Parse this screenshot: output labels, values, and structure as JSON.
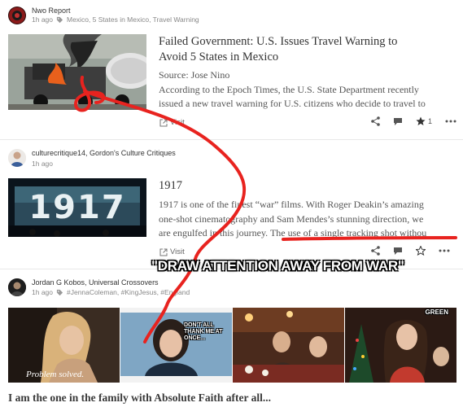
{
  "posts": [
    {
      "user": "Nwo Report",
      "time": "1h ago",
      "tags": "Mexico, 5 States in Mexico, Travel Warning",
      "title_line1": "Failed Government: U.S. Issues Travel Warning to",
      "title_line2": "Avoid 5 States in Mexico",
      "body_line1": "Source: Jose Nino",
      "body_line2": "According to the Epoch Times, the U.S. State Department recently",
      "body_line3": "issued a new travel warning for U.S. citizens who decide to travel to",
      "visit": "Visit",
      "star_count": "1"
    },
    {
      "user": "culturecritique14, Gordon's Culture Critiques",
      "time": "1h ago",
      "title": "1917",
      "thumb_text": "1917",
      "body_line1": "1917 is one of the finest “war” films. With Roger Deakin’s amazing",
      "body_line2": "one-shot cinematography and Sam Mendes’s stunning direction, we",
      "body_line3": "are engulfed in this journey. The use of a single tracking shot withou",
      "visit": "Visit"
    },
    {
      "user": "Jordan G Kobos, Universal Crossovers",
      "time": "1h ago",
      "tags": "#JennaColeman, #KingJesus, #England",
      "caption_problem": "Problem solved.",
      "caption_dont": "DON'T ALL THANK ME AT ONCE...",
      "caption_green": "GREEN",
      "title": "I am the one in the family with Absolute Faith after all..."
    }
  ],
  "annotation": {
    "text": "\"DRAW ATTENTION AWAY FROM WAR\"",
    "color": "#e8231f"
  },
  "icons": [
    "tag-icon",
    "external-link-icon",
    "share-icon",
    "comment-icon",
    "star-icon",
    "more-icon"
  ]
}
